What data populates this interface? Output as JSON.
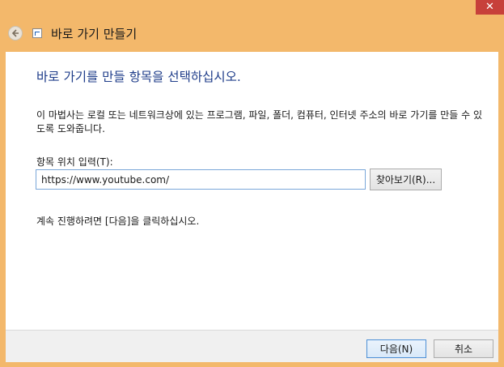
{
  "window": {
    "title": "바로 가기 만들기",
    "close_symbol": "✕",
    "back_icon": "back-arrow-icon",
    "app_icon": "shortcut-icon",
    "accent_color": "#f3b86b",
    "close_color": "#c7403a"
  },
  "content": {
    "heading": "바로 가기를 만들 항목을 선택하십시오.",
    "description": "이 마법사는 로컬 또는 네트워크상에 있는 프로그램, 파일, 폴더, 컴퓨터, 인터넷 주소의 바로 가기를 만들 수 있도록 도와줍니다.",
    "location_label": "항목 위치 입력(T):",
    "location_value": "https://www.youtube.com/",
    "browse_label": "찾아보기(R)...",
    "continue_text": "계속 진행하려면 [다음]을 클릭하십시오."
  },
  "footer": {
    "next_label": "다음(N)",
    "cancel_label": "취소"
  }
}
